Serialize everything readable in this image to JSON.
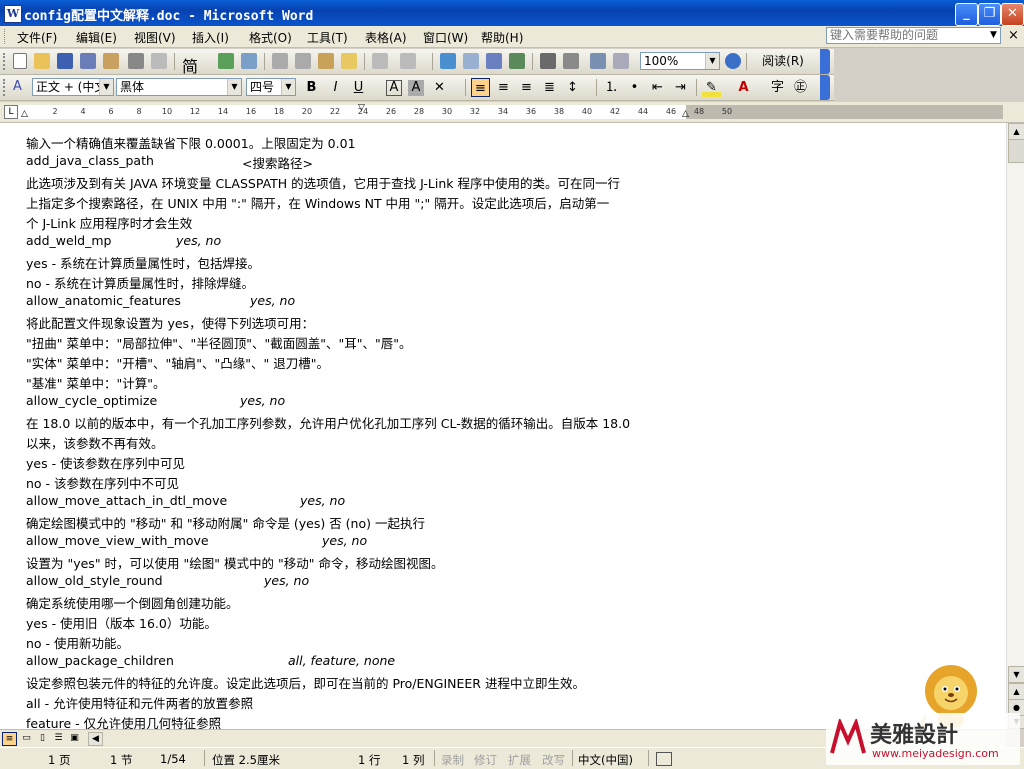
{
  "window": {
    "title": "config配置中文解释.doc - Microsoft Word",
    "min_glyph": "_",
    "max_glyph": "❐",
    "close_glyph": "✕"
  },
  "menu": {
    "items": [
      "文件(F)",
      "编辑(E)",
      "视图(V)",
      "插入(I)",
      "格式(O)",
      "工具(T)",
      "表格(A)",
      "窗口(W)",
      "帮助(H)"
    ],
    "help_placeholder": "键入需要帮助的问题",
    "doc_close": "×"
  },
  "toolbar": {
    "zoom": "100%",
    "read_label": "阅读(R)"
  },
  "format_toolbar": {
    "style": "正文 + (中文",
    "font": "黑体",
    "size": "四号",
    "bold": "B",
    "italic": "I",
    "underline": "U",
    "font_color_label": "A"
  },
  "ruler": {
    "ticks": [
      "2",
      "4",
      "6",
      "8",
      "10",
      "12",
      "14",
      "16",
      "18",
      "20",
      "22",
      "24",
      "26",
      "28",
      "30",
      "32",
      "34",
      "36",
      "38",
      "40",
      "42",
      "44",
      "46",
      "48",
      "50"
    ]
  },
  "document": {
    "lines": [
      {
        "text": "输入一个精确值来覆盖缺省下限 0.0001。上限固定为 0.01"
      },
      {
        "text": "add_java_class_path",
        "tail": "<搜索路径>"
      },
      {
        "text": "此选项涉及到有关 JAVA 环境变量 CLASSPATH 的选项值，它用于查找 J-Link 程序中使用的类。可在同一行"
      },
      {
        "text": "上指定多个搜索路径，在 UNIX 中用 \":\" 隔开，在 Windows NT 中用 \";\" 隔开。设定此选项后，启动第一"
      },
      {
        "text": "个 J-Link 应用程序时才会生效"
      },
      {
        "text": "add_weld_mp",
        "tail": "yes, no"
      },
      {
        "text": "yes - 系统在计算质量属性时，包括焊接。"
      },
      {
        "text": "no - 系统在计算质量属性时，排除焊缝。"
      },
      {
        "text": "allow_anatomic_features",
        "tail": "yes, no"
      },
      {
        "text": "将此配置文件现象设置为 yes，使得下列选项可用："
      },
      {
        "text": "\"扭曲\" 菜单中：\"局部拉伸\"、\"半径圆顶\"、\"截面圆盖\"、\"耳\"、\"唇\"。"
      },
      {
        "text": "\"实体\" 菜单中：\"开槽\"、\"轴肩\"、\"凸缘\"、\" 退刀槽\"。"
      },
      {
        "text": "\"基准\" 菜单中：\"计算\"。"
      },
      {
        "text": "allow_cycle_optimize",
        "tail": "yes, no"
      },
      {
        "text": "在 18.0 以前的版本中，有一个孔加工序列参数，允许用户优化孔加工序列 CL-数据的循环输出。自版本 18.0"
      },
      {
        "text": "以来，该参数不再有效。"
      },
      {
        "text": "yes - 使该参数在序列中可见"
      },
      {
        "text": "no - 该参数在序列中不可见"
      },
      {
        "text": "allow_move_attach_in_dtl_move",
        "tail": "yes, no"
      },
      {
        "text": "确定绘图模式中的 \"移动\" 和 \"移动附属\" 命令是 (yes) 否 (no) 一起执行"
      },
      {
        "text": "allow_move_view_with_move",
        "tail": "yes, no"
      },
      {
        "text": "设置为 \"yes\" 时，可以使用 \"绘图\" 模式中的 \"移动\" 命令，移动绘图视图。"
      },
      {
        "text": "allow_old_style_round",
        "tail": "yes, no"
      },
      {
        "text": "确定系统使用哪一个倒圆角创建功能。"
      },
      {
        "text": "yes - 使用旧（版本 16.0）功能。"
      },
      {
        "text": "no - 使用新功能。"
      },
      {
        "text": "allow_package_children",
        "tail": "all, feature, none"
      },
      {
        "text": "设定参照包装元件的特征的允许度。设定此选项后，即可在当前的 Pro/ENGINEER 进程中立即生效。"
      },
      {
        "text": "all - 允许使用特征和元件两者的放置参照"
      },
      {
        "text": "feature - 仅允许使用几何特征参照"
      }
    ]
  },
  "status": {
    "page": "1 页",
    "section": "1 节",
    "page_of": "1/54",
    "position": "位置 2.5厘米",
    "line": "1 行",
    "col": "1 列",
    "rec": "录制",
    "trk": "修订",
    "ext": "扩展",
    "ovr": "改写",
    "lang": "中文(中国)"
  },
  "watermark": {
    "brand": "美雅設計",
    "url": "www.meiyadesign.com"
  }
}
